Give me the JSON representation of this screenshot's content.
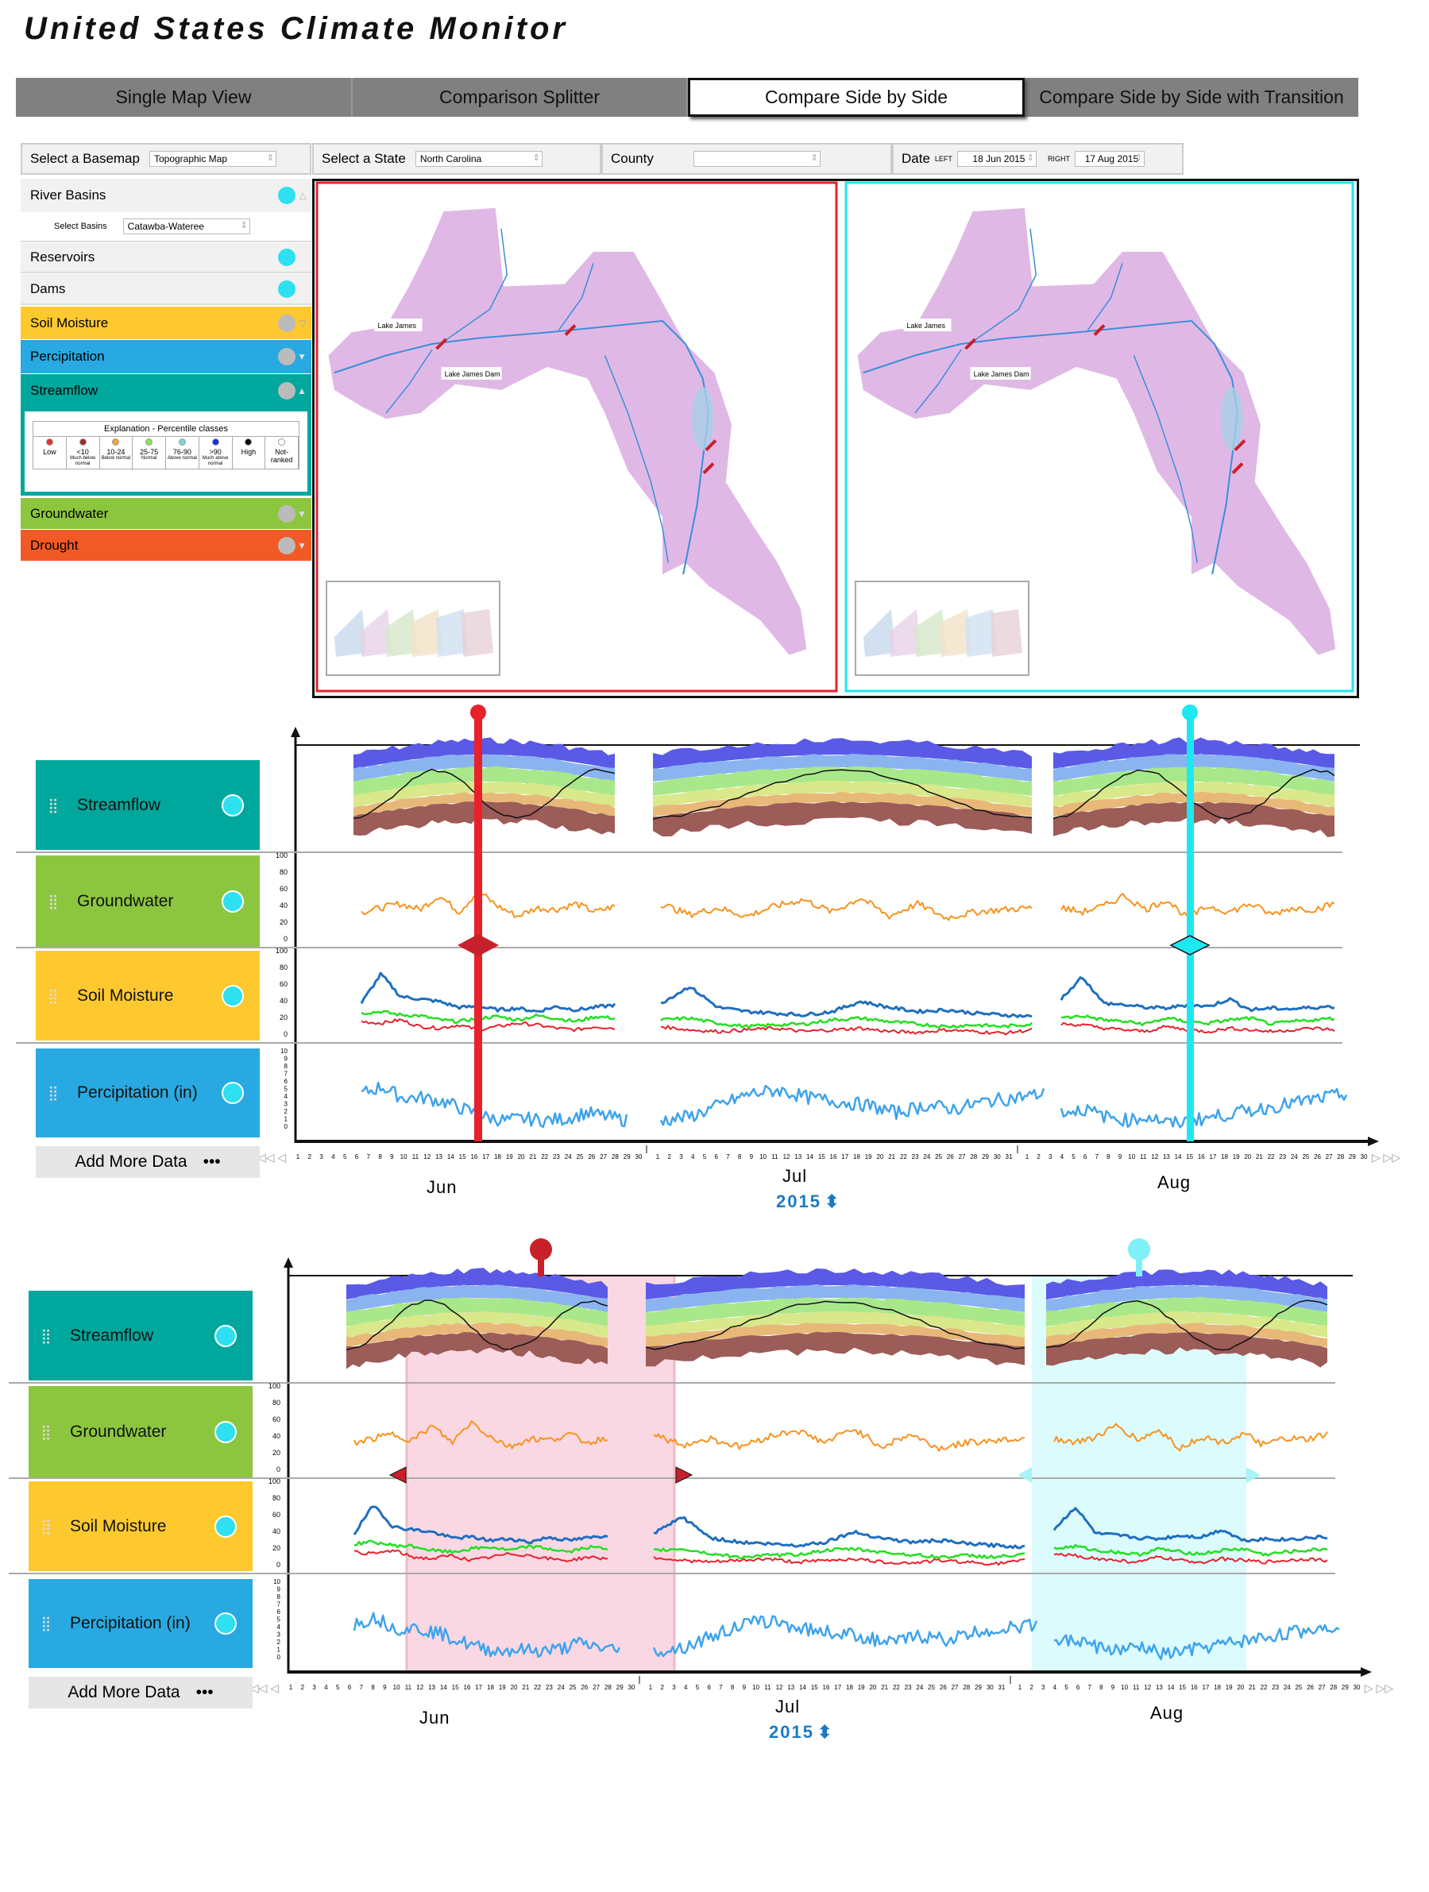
{
  "app_title": "United States Climate Monitor",
  "tabs": [
    {
      "label": "Single Map View"
    },
    {
      "label": "Comparison Splitter"
    },
    {
      "label": "Compare Side by Side",
      "active": true
    },
    {
      "label": "Compare Side by Side with Transition"
    }
  ],
  "controls": {
    "basemap_label": "Select a Basemap",
    "basemap_value": "Topographic Map",
    "state_label": "Select a State",
    "state_value": "North Carolina",
    "county_label": "County",
    "county_value": "",
    "date_label": "Date",
    "left_label": "LEFT",
    "left_value": "18 Jun 2015",
    "right_label": "RIGHT",
    "right_value": "17 Aug 2015"
  },
  "sidebar": {
    "river_basins": "River Basins",
    "select_basins_label": "Select Basins",
    "select_basins_value": "Catawba-Wateree",
    "reservoirs": "Reservoirs",
    "dams": "Dams",
    "soil_moisture": "Soil Moisture",
    "precipitation": "Percipitation",
    "streamflow": "Streamflow",
    "groundwater": "Groundwater",
    "drought": "Drought",
    "legend": {
      "title": "Explanation - Percentile classes",
      "classes": [
        {
          "top": "Low",
          "bottom": "",
          "color": "#e0352b"
        },
        {
          "top": "<10",
          "bottom": "Much below normal",
          "color": "#9b2d26"
        },
        {
          "top": "10-24",
          "bottom": "Below normal",
          "color": "#f0a73c"
        },
        {
          "top": "25-75",
          "bottom": "Normal",
          "color": "#8fe35a"
        },
        {
          "top": "76-90",
          "bottom": "Above normal",
          "color": "#7fd9d2"
        },
        {
          "top": ">90",
          "bottom": "Much above normal",
          "color": "#1530e0"
        },
        {
          "top": "High",
          "bottom": "",
          "color": "#000000"
        },
        {
          "top": "Not-ranked",
          "bottom": "",
          "color": "#ffffff"
        }
      ]
    }
  },
  "maps": {
    "lake_label": "Lake James",
    "dam_label": "Lake James Dam",
    "left_border": "#e8212b",
    "right_border": "#1de8f0",
    "basin_color": "#e0b8e6",
    "river_color": "#3a8fd8"
  },
  "colors": {
    "streamflow": "#00a79d",
    "groundwater": "#8cc63f",
    "soil_moisture": "#fdc92f",
    "precipitation": "#29a9e1",
    "drought": "#f15a24",
    "left_cursor": "#e8212b",
    "right_cursor": "#1de8f0"
  },
  "timeline1": {
    "rows": [
      "Streamflow",
      "Groundwater",
      "Soil Moisture",
      "Percipitation (in)"
    ],
    "add_more": "Add More Data",
    "more_icon": "•••",
    "months": [
      "Jun",
      "Jul",
      "Aug"
    ],
    "year": "2015"
  },
  "timeline2": {
    "rows": [
      "Streamflow",
      "Groundwater",
      "Soil Moisture",
      "Percipitation (in)"
    ],
    "add_more": "Add More Data",
    "more_icon": "•••",
    "months": [
      "Jun",
      "Jul",
      "Aug"
    ],
    "year": "2015"
  },
  "axes": {
    "percent_ticks": [
      "100",
      "80",
      "60",
      "40",
      "20",
      "0"
    ],
    "precip_ticks": [
      "10",
      "9",
      "8",
      "7",
      "6",
      "5",
      "4",
      "3",
      "2",
      "1",
      "0"
    ],
    "month_days": [
      30,
      31,
      30
    ]
  },
  "chart_data": {
    "type": "line",
    "groundwater": [
      [
        35,
        40,
        45,
        38,
        55,
        35,
        60,
        42,
        30,
        40,
        38,
        45,
        35,
        42
      ],
      [
        45,
        32,
        40,
        30,
        42,
        50,
        35,
        52,
        30,
        45,
        28,
        35,
        38,
        40
      ],
      [
        40,
        35,
        42,
        55,
        38,
        50,
        28,
        42,
        35,
        45,
        32,
        40,
        38,
        45
      ]
    ],
    "soil_moisture_blue": [
      [
        40,
        75,
        48,
        45,
        42,
        35,
        36,
        32,
        34,
        30,
        36,
        32,
        35,
        38
      ],
      [
        40,
        60,
        35,
        30,
        28,
        26,
        30,
        42,
        35,
        30,
        32,
        28,
        26,
        24
      ],
      [
        45,
        72,
        40,
        38,
        35,
        34,
        38,
        36,
        45,
        32,
        34,
        33,
        35,
        36
      ]
    ],
    "soil_moisture_green": [
      [
        28,
        30,
        26,
        25,
        20,
        18,
        22,
        24,
        20,
        25,
        22,
        18,
        24,
        22
      ],
      [
        20,
        22,
        16,
        12,
        14,
        15,
        20,
        22,
        18,
        15,
        12,
        14,
        12,
        15
      ],
      [
        22,
        25,
        20,
        18,
        15,
        22,
        18,
        16,
        20,
        22,
        15,
        18,
        20,
        22
      ]
    ],
    "soil_moisture_red": [
      [
        18,
        16,
        20,
        12,
        10,
        14,
        8,
        12,
        16,
        14,
        10,
        8,
        12,
        10
      ],
      [
        12,
        8,
        6,
        8,
        10,
        6,
        8,
        10,
        6,
        5,
        8,
        6,
        4,
        8
      ],
      [
        15,
        14,
        10,
        8,
        6,
        12,
        8,
        6,
        10,
        8,
        6,
        8,
        10,
        8
      ]
    ],
    "precipitation": [
      [
        4.5,
        5.5,
        4,
        4,
        3.5,
        2.5,
        1.5,
        1,
        1.2,
        1,
        1.2,
        2,
        1.5,
        1
      ],
      [
        1,
        1.5,
        3,
        4.5,
        5,
        4,
        3.5,
        3,
        2,
        3,
        2.5,
        3.5,
        4,
        4.5
      ],
      [
        2,
        2.5,
        1.5,
        1,
        1.5,
        0.5,
        1,
        1.5,
        2,
        2.5,
        3,
        3.5,
        4,
        4.5
      ]
    ]
  }
}
